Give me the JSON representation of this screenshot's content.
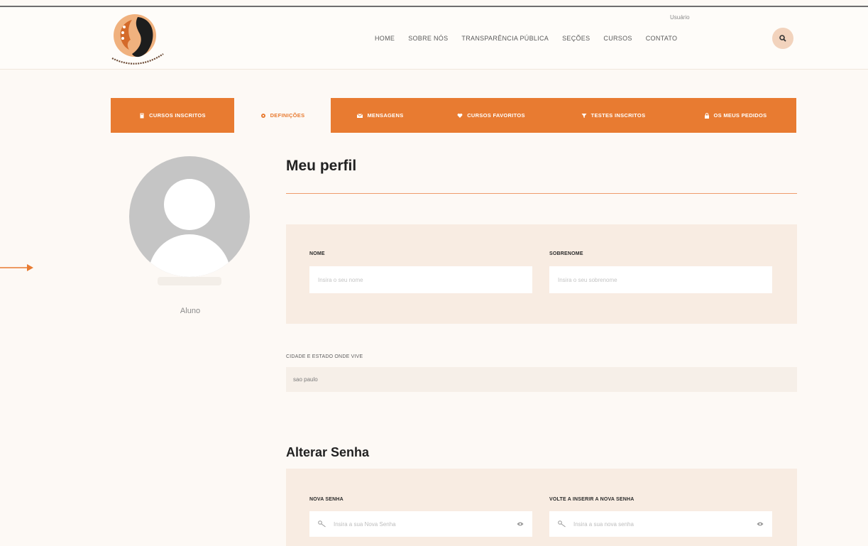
{
  "header": {
    "logo_alt": "Associação Mulheres...",
    "user_label": "Usuário",
    "nav": [
      "HOME",
      "SOBRE NÓS",
      "TRANSPARÊNCIA PÚBLICA",
      "SEÇÕES",
      "CURSOS",
      "CONTATO"
    ],
    "search_icon": "search-icon"
  },
  "tabs": [
    {
      "label": "CURSOS INSCRITOS",
      "icon": "book-icon",
      "active": false
    },
    {
      "label": "DEFINIÇÕES",
      "icon": "gear-icon",
      "active": true
    },
    {
      "label": "MENSAGENS",
      "icon": "envelope-icon",
      "active": false
    },
    {
      "label": "CURSOS FAVORITOS",
      "icon": "heart-icon",
      "active": false
    },
    {
      "label": "TESTES INSCRITOS",
      "icon": "funnel-icon",
      "active": false
    },
    {
      "label": "OS MEUS PEDIDOS",
      "icon": "lock-icon",
      "active": false
    }
  ],
  "profile": {
    "role": "Aluno"
  },
  "main": {
    "title": "Meu perfil",
    "first_name_label": "NOME",
    "first_name_placeholder": "Insira o seu nome",
    "last_name_label": "SOBRENOME",
    "last_name_placeholder": "Insira o seu sobrenome",
    "city_label": "CIDADE E ESTADO ONDE VIVE",
    "city_value": "sao paulo",
    "password_section_title": "Alterar Senha",
    "new_password_label": "NOVA SENHA",
    "new_password_placeholder": "Insira a sua Nova Senha",
    "confirm_password_label": "VOLTE A INSERIR A NOVA SENHA",
    "confirm_password_placeholder": "Insira a sua nova senha"
  },
  "colors": {
    "accent": "#e87b31",
    "background": "#fdf9f5",
    "panel": "#f8ece2",
    "search_button": "#f2d3bd"
  }
}
